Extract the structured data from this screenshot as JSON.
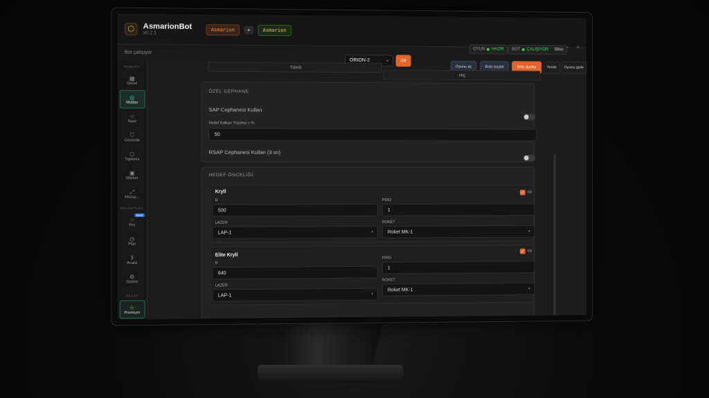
{
  "app": {
    "name": "AsmarionBot",
    "version": "v0.2.1",
    "tabs": [
      "Asmarion",
      "+",
      "Asmarion"
    ],
    "bot_status_text": "Bot çalışıyor"
  },
  "status": {
    "game_label": "OYUN",
    "game_value": "HAZIR",
    "bot_label": "BOT",
    "bot_value": "ÇALIŞIYOR",
    "timer": "59sn",
    "minimize": "−",
    "close": "×"
  },
  "sidebar": {
    "section_main": "KOMUTA",
    "section_plugins": "EKLENTİLER",
    "section_account": "HESAP",
    "items": [
      {
        "label": "Genel",
        "icon": "grid-icon",
        "glyph": "▦"
      },
      {
        "label": "Moblar",
        "icon": "target-icon",
        "glyph": "◎"
      },
      {
        "label": "Raid",
        "icon": "star-icon",
        "glyph": "☆"
      },
      {
        "label": "Güvenlik",
        "icon": "shield-icon",
        "glyph": "⛉"
      },
      {
        "label": "Toplama",
        "icon": "cube-icon",
        "glyph": "⬡"
      },
      {
        "label": "Market",
        "icon": "bag-icon",
        "glyph": "▣"
      },
      {
        "label": "Müzay...",
        "icon": "external-icon",
        "glyph": "⤢"
      }
    ],
    "plugin_items": [
      {
        "label": "Pro",
        "icon": "star-icon",
        "glyph": "☆",
        "badge": "NEW"
      },
      {
        "label": "Plan",
        "icon": "clock-icon",
        "glyph": "◷"
      },
      {
        "label": "Analiz",
        "icon": "chart-icon",
        "glyph": "⫴"
      },
      {
        "label": "Sistem",
        "icon": "gear-icon",
        "glyph": "⚙"
      }
    ],
    "premium": {
      "label": "Premium",
      "icon": "star-icon",
      "glyph": "☆"
    }
  },
  "toolbar": {
    "map_select": "ORION-2",
    "go_button": "Git",
    "start_game": "Oyunu aç",
    "start_bot": "Botu başlat",
    "stop_bot": "Botu durdur",
    "refresh": "Yenile",
    "hide_game": "Oyunu gizle"
  },
  "filters": {
    "all": "Tümü",
    "none": "Hiç"
  },
  "ammo": {
    "title": "ÖZEL CEPHANE",
    "sap_label": "SAP Cephanesi Kullan",
    "shield_label": "Hedef Kalkan Yüzdesi > %",
    "shield_value": "50",
    "rsap_label": "RSAP Cephanesi Kullan (3 sn)"
  },
  "targets": {
    "title": "HEDEF ÖNCELİĞİ",
    "kill_label": "Kill",
    "r_label": "R",
    "prio_label": "PRİO",
    "laser_label": "LAZER",
    "rocket_label": "ROKET",
    "items": [
      {
        "name": "Kryll",
        "r": "500",
        "prio": "1",
        "laser": "LAP-1",
        "rocket": "Roket MK-1"
      },
      {
        "name": "Elite Kryll",
        "r": "640",
        "prio": "1",
        "laser": "LAP-1",
        "rocket": "Roket MK-1"
      }
    ]
  },
  "colors": {
    "accent": "#e0662a",
    "active_teal": "#4ad0b0",
    "ok_green": "#3ecf5e"
  }
}
